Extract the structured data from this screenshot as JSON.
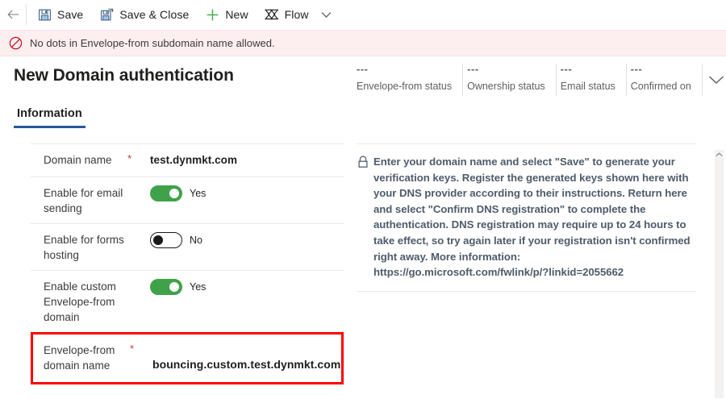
{
  "theme": {
    "accent": "#2b579a",
    "toggle_on": "#3fa24a",
    "error_border": "#ff0000",
    "notif_bg": "#fdeef0",
    "notif_icon": "#c50f1f",
    "help_text": "#4e5b6a",
    "new_icon": "#4cae4f"
  },
  "commandbar": {
    "back_icon": "arrow-left-icon",
    "buttons": [
      {
        "label": "Save",
        "icon": "save-disk-icon"
      },
      {
        "label": "Save & Close",
        "icon": "save-and-close-icon"
      },
      {
        "label": "New",
        "icon": "plus-icon"
      },
      {
        "label": "Flow",
        "icon": "flow-icon"
      }
    ],
    "overflow_icon": "chevron-down-icon"
  },
  "notification": {
    "icon": "block-prohibited-icon",
    "message": "No dots in Envelope-from subdomain name allowed."
  },
  "header": {
    "title": "New Domain authentication",
    "status_items": [
      {
        "value": "---",
        "label": "Envelope-from status"
      },
      {
        "value": "---",
        "label": "Ownership status"
      },
      {
        "value": "---",
        "label": "Email status"
      },
      {
        "value": "---",
        "label": "Confirmed on"
      }
    ],
    "expand_icon": "chevron-down-icon"
  },
  "tabs": [
    {
      "label": "Information",
      "selected": true
    }
  ],
  "form": {
    "rows": [
      {
        "label": "Domain name",
        "required": "*",
        "type": "text",
        "value": "test.dynmkt.com",
        "highlight": false
      },
      {
        "label": "Enable for email sending",
        "required": "",
        "type": "toggle",
        "state": "on",
        "value": "Yes",
        "highlight": false
      },
      {
        "label": "Enable for forms hosting",
        "required": "",
        "type": "toggle",
        "state": "off",
        "value": "No",
        "highlight": false
      },
      {
        "label": "Enable custom Envelope-from domain",
        "required": "",
        "type": "toggle",
        "state": "on",
        "value": "Yes",
        "highlight": false
      },
      {
        "label": "Envelope-from domain name",
        "required": "*",
        "type": "text",
        "value": "bouncing.custom.test.dynmkt.com",
        "highlight": true
      }
    ]
  },
  "help": {
    "icon": "lock-icon",
    "text": "Enter your domain name and select \"Save\" to generate your verification keys. Register the generated keys shown here with your DNS provider according to their instructions. Return here and select \"Confirm DNS registration\" to complete the authentication. DNS registration may require up to 24 hours to take effect, so try again later if your registration isn't confirmed right away. More information: https://go.microsoft.com/fwlink/p/?linkid=2055662"
  },
  "scrollbar": {
    "up_arrow_icon": "chevron-up-icon"
  }
}
